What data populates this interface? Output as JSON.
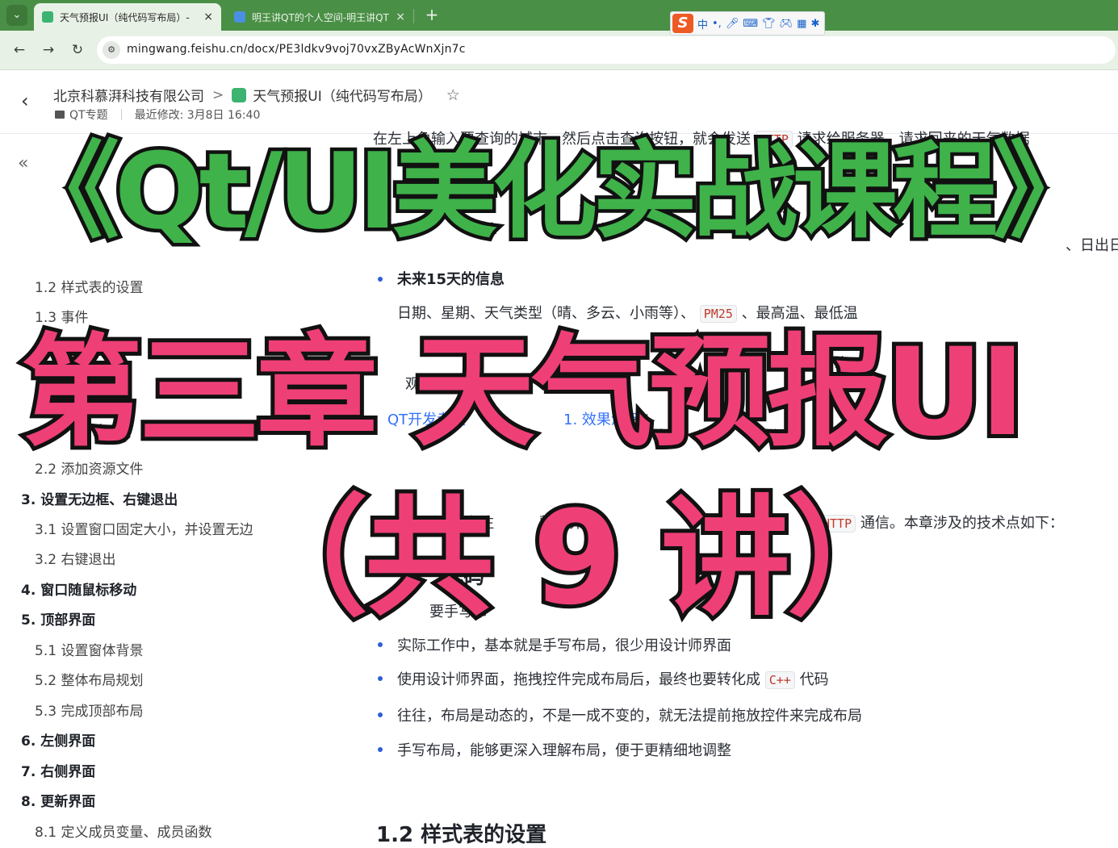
{
  "browser": {
    "tabs": [
      {
        "title": "天气预报UI（纯代码写布局）-",
        "favicon_color": "#3cb371",
        "close": "×"
      },
      {
        "title": "明王讲QT的个人空间-明王讲QT",
        "favicon_color": "#4a90e2",
        "close": "×"
      }
    ],
    "new_tab": "+",
    "url": "mingwang.feishu.cn/docx/PE3ldkv9voj70vxZByAcWnXjn7c",
    "ime": {
      "logo": "S",
      "mode": "中"
    }
  },
  "doc_header": {
    "breadcrumb_space": "北京科慕湃科技有限公司",
    "breadcrumb_sep": ">",
    "doc_title": "天气预报UI（纯代码写布局）",
    "folder": "QT专题",
    "last_modified": "最近修改: 3月8日 16:40"
  },
  "sidebar": {
    "toc": [
      {
        "label": "1.2 样式表的设置",
        "level": 2
      },
      {
        "label": "1.3 事件",
        "level": 2
      },
      {
        "label": "2.2 添加资源文件",
        "level": 2
      },
      {
        "label": "3. 设置无边框、右键退出",
        "level": 1
      },
      {
        "label": "3.1 设置窗口固定大小，并设置无边",
        "level": 2
      },
      {
        "label": "3.2 右键退出",
        "level": 2
      },
      {
        "label": "4. 窗口随鼠标移动",
        "level": 1
      },
      {
        "label": "5. 顶部界面",
        "level": 1
      },
      {
        "label": "5.1 设置窗体背景",
        "level": 2
      },
      {
        "label": "5.2 整体布局规划",
        "level": 2
      },
      {
        "label": "5.3 完成顶部布局",
        "level": 2
      },
      {
        "label": "6. 左侧界面",
        "level": 1
      },
      {
        "label": "7. 右侧界面",
        "level": 1
      },
      {
        "label": "8. 更新界面",
        "level": 1
      },
      {
        "label": "8.1 定义成员变量、成员函数",
        "level": 2
      }
    ]
  },
  "content": {
    "line_top": "在左上角输入要查询的城市，然后点击查询按钮，就会发送",
    "code_http": "HTTP",
    "line_top_2": "请求给服务器，请求回来的天气数据",
    "line_right": "、日出日",
    "bullet_15days": "未来15天的信息",
    "line_15days_a": "日期、星期、天气类型（晴、多云、小雨等）、",
    "code_pm25": "PM25",
    "line_15days_b": "、最高温、最低温",
    "watch_fragment": "观看",
    "link_fragment": "QT开发专题",
    "link_fragment_2": "1. 效果演示",
    "line_tech_a": "我们专注",
    "line_tech_b": "整个界面",
    "line_tech_c": "通信。本章涉及的技术点如下：",
    "heading_code": "代码",
    "line_why": "要手写布",
    "bullet1": "实际工作中，基本就是手写布局，很少用设计师界面",
    "bullet2_a": "使用设计师界面，拖拽控件完成布局后，最终也要转化成",
    "code_cpp": "C++",
    "bullet2_b": "代码",
    "bullet3": "往往，布局是动态的，不是一成不变的，就无法提前拖放控件来完成布局",
    "bullet4": "手写布局，能够更深入理解布局，便于更精细地调整",
    "heading_style": "1.2 样式表的设置"
  },
  "overlay": {
    "title": "《Qt/UI美化实战课程》",
    "chapter": "第三章 天气预报UI",
    "count": "（共 9 讲）",
    "green": "#3fb24a",
    "pink": "#ef3f77"
  }
}
